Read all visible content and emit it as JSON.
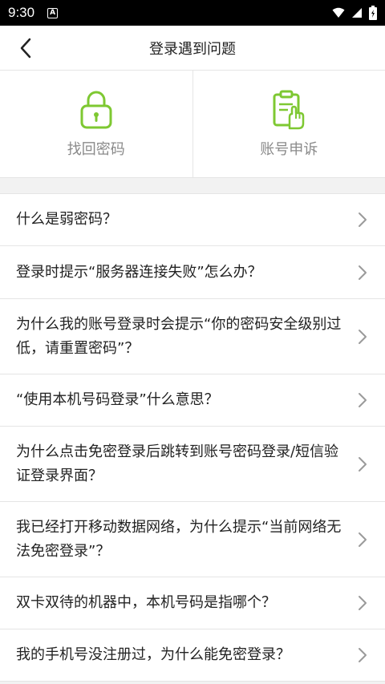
{
  "status_bar": {
    "time": "9:30",
    "notification_badge": "A",
    "icons": [
      "wifi-icon",
      "signal-icon",
      "battery-icon"
    ]
  },
  "header": {
    "title": "登录遇到问题",
    "back_icon": "chevron-left-icon"
  },
  "quick_actions": [
    {
      "label": "找回密码",
      "icon": "lock-icon",
      "color": "#7ec832"
    },
    {
      "label": "账号申诉",
      "icon": "clipboard-hand-icon",
      "color": "#7ec832"
    }
  ],
  "faq": [
    {
      "question": "什么是弱密码？"
    },
    {
      "question": "登录时提示“服务器连接失败”怎么办？"
    },
    {
      "question": "为什么我的账号登录时会提示“你的密码安全级别过低，请重置密码”？"
    },
    {
      "question": "“使用本机号码登录”什么意思？"
    },
    {
      "question": "为什么点击免密登录后跳转到账号密码登录/短信验证登录界面？"
    },
    {
      "question": "我已经打开移动数据网络，为什么提示“当前网络无法免密登录”？"
    },
    {
      "question": "双卡双待的机器中，本机号码是指哪个？"
    },
    {
      "question": "我的手机号没注册过，为什么能免密登录？"
    }
  ],
  "colors": {
    "accent": "#7ec832",
    "chevron": "#9a9a9a"
  }
}
